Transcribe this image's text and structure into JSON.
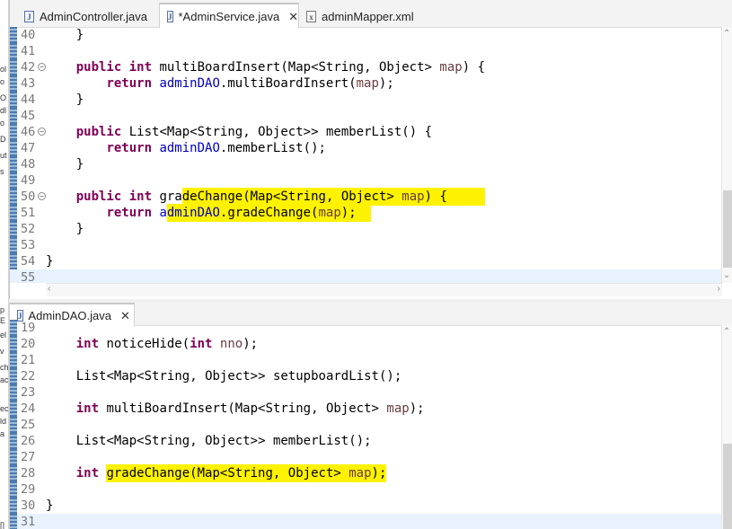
{
  "left_strip_chars": [
    "ol",
    "o",
    "O",
    "dl",
    "o",
    "D",
    "ut",
    "s",
    "p",
    "E",
    "el",
    "v",
    "ch",
    "ac",
    "ec",
    "ld",
    "a",
    "[]"
  ],
  "top_editor": {
    "tabs": [
      {
        "label": "AdminController.java",
        "icon": "java-file-icon",
        "active": false
      },
      {
        "label": "*AdminService.java",
        "icon": "java-file-icon",
        "active": true
      },
      {
        "label": "adminMapper.xml",
        "icon": "xml-file-icon",
        "active": false
      }
    ],
    "close_glyph": "✕",
    "lines": [
      {
        "n": "40",
        "text": "    }"
      },
      {
        "n": "41",
        "text": ""
      },
      {
        "n": "42",
        "text": "    public int multiBoardInsert(Map<String, Object> map) {",
        "fold": true
      },
      {
        "n": "43",
        "text": "        return adminDAO.multiBoardInsert(map);"
      },
      {
        "n": "44",
        "text": "    }"
      },
      {
        "n": "45",
        "text": ""
      },
      {
        "n": "46",
        "text": "    public List<Map<String, Object>> memberList() {",
        "fold": true
      },
      {
        "n": "47",
        "text": "        return adminDAO.memberList();"
      },
      {
        "n": "48",
        "text": "    }"
      },
      {
        "n": "49",
        "text": ""
      },
      {
        "n": "50",
        "text": "    public int gradeChange(Map<String, Object> map) {",
        "fold": true
      },
      {
        "n": "51",
        "text": "        return adminDAO.gradeChange(map);"
      },
      {
        "n": "52",
        "text": "    }"
      },
      {
        "n": "53",
        "text": ""
      },
      {
        "n": "54",
        "text": "}"
      },
      {
        "n": "55",
        "text": ""
      }
    ]
  },
  "bottom_editor": {
    "tabs": [
      {
        "label": "AdminDAO.java",
        "icon": "java-file-icon",
        "active": true
      }
    ],
    "close_glyph": "✕",
    "lines": [
      {
        "n": "19",
        "text": ""
      },
      {
        "n": "20",
        "text": "    int noticeHide(int nno);"
      },
      {
        "n": "21",
        "text": ""
      },
      {
        "n": "22",
        "text": "    List<Map<String, Object>> setupboardList();"
      },
      {
        "n": "23",
        "text": ""
      },
      {
        "n": "24",
        "text": "    int multiBoardInsert(Map<String, Object> map);"
      },
      {
        "n": "25",
        "text": ""
      },
      {
        "n": "26",
        "text": "    List<Map<String, Object>> memberList();"
      },
      {
        "n": "27",
        "text": ""
      },
      {
        "n": "28",
        "text": "    int gradeChange(Map<String, Object> map);"
      },
      {
        "n": "29",
        "text": ""
      },
      {
        "n": "30",
        "text": "}"
      },
      {
        "n": "31",
        "text": ""
      }
    ]
  },
  "colors": {
    "keyword": "#7f0055",
    "field": "#0000c0",
    "parameter": "#6a3e3e",
    "highlight": "#fff200",
    "current_line": "#e8f2fe"
  }
}
